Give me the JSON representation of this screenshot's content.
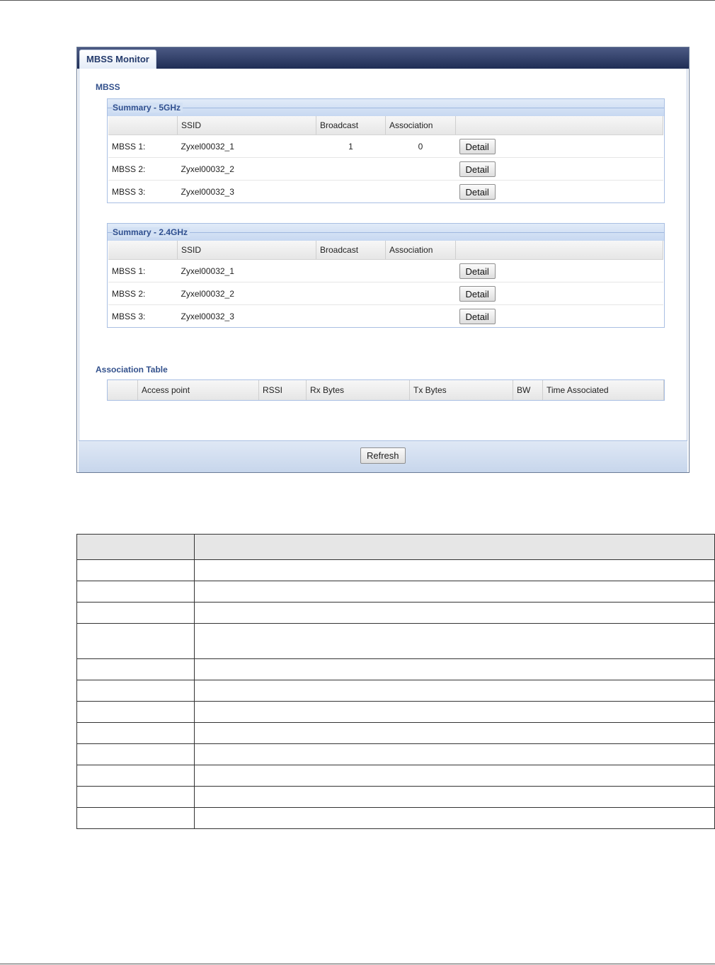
{
  "window": {
    "tab_label": "MBSS Monitor"
  },
  "mbss_section": {
    "title": "MBSS"
  },
  "summary_5ghz": {
    "title": "Summary - 5GHz",
    "headers": [
      "",
      "SSID",
      "Broadcast",
      "Association",
      ""
    ],
    "rows": [
      {
        "label": "MBSS 1:",
        "ssid": "Zyxel00032_1",
        "broadcast": "1",
        "association": "0",
        "button": "Detail"
      },
      {
        "label": "MBSS 2:",
        "ssid": "Zyxel00032_2",
        "broadcast": "",
        "association": "",
        "button": "Detail"
      },
      {
        "label": "MBSS 3:",
        "ssid": "Zyxel00032_3",
        "broadcast": "",
        "association": "",
        "button": "Detail"
      }
    ]
  },
  "summary_24ghz": {
    "title": "Summary - 2.4GHz",
    "headers": [
      "",
      "SSID",
      "Broadcast",
      "Association",
      ""
    ],
    "rows": [
      {
        "label": "MBSS 1:",
        "ssid": "Zyxel00032_1",
        "broadcast": "",
        "association": "",
        "button": "Detail"
      },
      {
        "label": "MBSS 2:",
        "ssid": "Zyxel00032_2",
        "broadcast": "",
        "association": "",
        "button": "Detail"
      },
      {
        "label": "MBSS 3:",
        "ssid": "Zyxel00032_3",
        "broadcast": "",
        "association": "",
        "button": "Detail"
      }
    ]
  },
  "association_table": {
    "title": "Association Table",
    "headers": [
      "",
      "Access point",
      "RSSI",
      "Rx Bytes",
      "Tx Bytes",
      "BW",
      "Time Associated"
    ]
  },
  "footer": {
    "refresh_label": "Refresh"
  }
}
